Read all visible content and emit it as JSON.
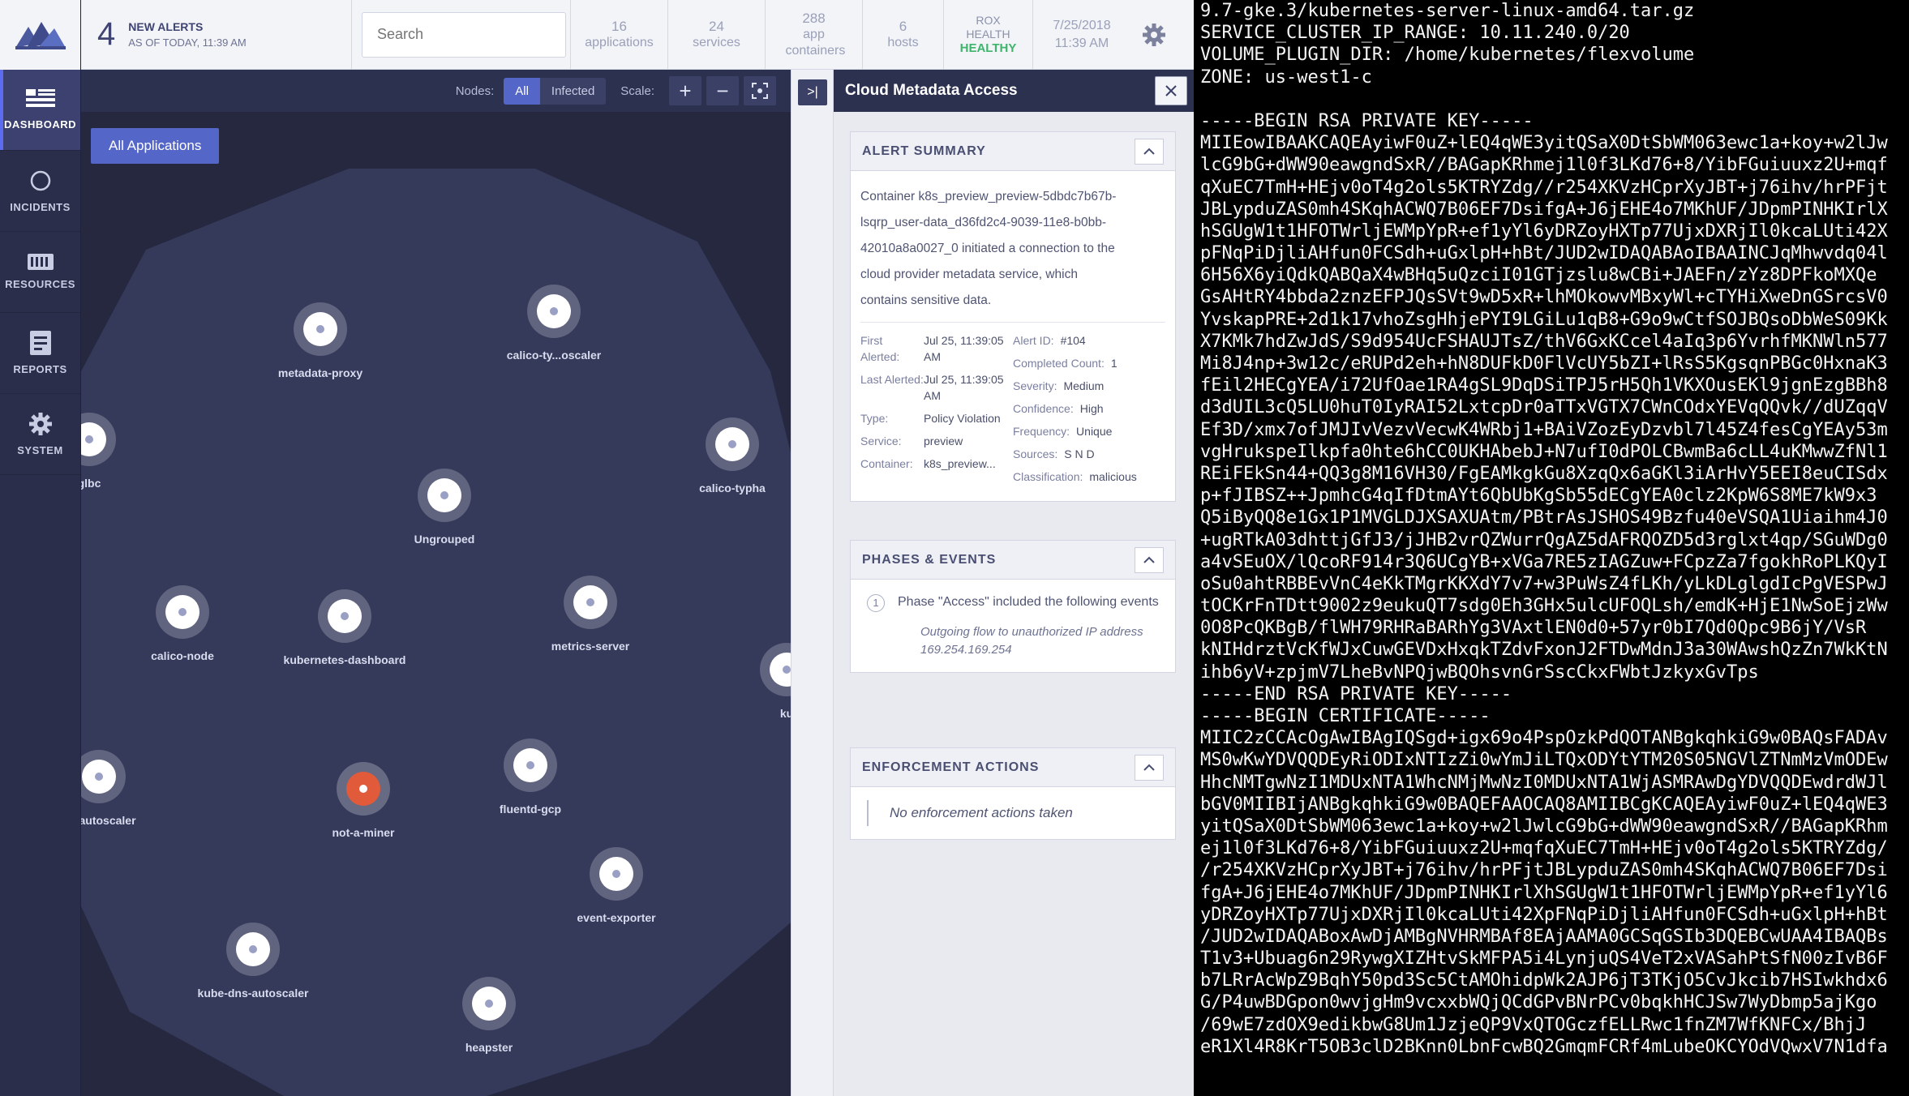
{
  "nav": {
    "items": [
      {
        "label": "DASHBOARD"
      },
      {
        "label": "INCIDENTS"
      },
      {
        "label": "RESOURCES"
      },
      {
        "label": "REPORTS"
      },
      {
        "label": "SYSTEM"
      }
    ]
  },
  "header": {
    "alert_count": "4",
    "alert_title": "NEW ALERTS",
    "alert_sub": "AS OF TODAY, 11:39 AM",
    "search_placeholder": "Search",
    "stats": [
      {
        "num": "16",
        "label": "applications"
      },
      {
        "num": "24",
        "label": "services"
      },
      {
        "num": "288",
        "label": "app containers"
      },
      {
        "num": "6",
        "label": "hosts"
      }
    ],
    "health_line1": "ROX",
    "health_line2": "HEALTH",
    "health_status": "HEALTHY",
    "date": "7/25/2018",
    "time": "11:39 AM"
  },
  "toolbar": {
    "nodes_label": "Nodes:",
    "filter_all": "All",
    "filter_infected": "Infected",
    "scale_label": "Scale:",
    "zoom_in": "+",
    "zoom_out": "−"
  },
  "graph": {
    "all_apps": "All Applications",
    "nodes": [
      {
        "name": "metadata-proxy",
        "status": "normal"
      },
      {
        "name": "calico-ty...oscaler",
        "status": "normal"
      },
      {
        "name": "glbc",
        "status": "normal"
      },
      {
        "name": "calico-typha",
        "status": "normal"
      },
      {
        "name": "Ungrouped",
        "status": "normal"
      },
      {
        "name": "calico-node",
        "status": "normal"
      },
      {
        "name": "kubernetes-dashboard",
        "status": "normal"
      },
      {
        "name": "metrics-server",
        "status": "normal"
      },
      {
        "name": "ku",
        "status": "normal"
      },
      {
        "name": "de-autoscaler",
        "status": "normal"
      },
      {
        "name": "not-a-miner",
        "status": "alert"
      },
      {
        "name": "fluentd-gcp",
        "status": "normal"
      },
      {
        "name": "event-exporter",
        "status": "normal"
      },
      {
        "name": "kube-dns-autoscaler",
        "status": "normal"
      },
      {
        "name": "heapster",
        "status": "normal"
      }
    ]
  },
  "panel": {
    "collapse_label": ">|",
    "title": "Cloud Metadata Access",
    "summary": {
      "heading": "ALERT SUMMARY",
      "lines": [
        "Container k8s_preview_preview-5dbdc7b67b-",
        "lsqrp_user-data_d36fd2c4-9039-11e8-b0bb-",
        "42010a8a0027_0 initiated a connection to the",
        "cloud provider metadata service, which",
        "contains sensitive data."
      ],
      "left": [
        {
          "k": "First Alerted:",
          "v": "Jul 25, 11:39:05 AM"
        },
        {
          "k": "Last Alerted:",
          "v": "Jul 25, 11:39:05 AM"
        },
        {
          "k": "Type:",
          "v": "Policy Violation"
        },
        {
          "k": "Service:",
          "v": "preview"
        },
        {
          "k": "Container:",
          "v": "k8s_preview..."
        }
      ],
      "right": [
        {
          "k": "Alert ID:",
          "v": "#104"
        },
        {
          "k": "Completed Count:",
          "v": "1"
        },
        {
          "k": "Severity:",
          "v": "Medium"
        },
        {
          "k": "Confidence:",
          "v": "High"
        },
        {
          "k": "Frequency:",
          "v": "Unique"
        },
        {
          "k": "Sources:",
          "v": "S N D"
        },
        {
          "k": "Classification:",
          "v": "malicious"
        }
      ]
    },
    "phases": {
      "heading": "PHASES & EVENTS",
      "num": "1",
      "text": "Phase \"Access\" included the following events",
      "event": "Outgoing flow to unauthorized IP address 169.254.169.254"
    },
    "enforcement": {
      "heading": "ENFORCEMENT ACTIONS",
      "text": "No enforcement actions taken"
    }
  },
  "terminal": {
    "lines": [
      "9.7-gke.3/kubernetes-server-linux-amd64.tar.gz",
      "SERVICE_CLUSTER_IP_RANGE: 10.11.240.0/20",
      "VOLUME_PLUGIN_DIR: /home/kubernetes/flexvolume",
      "ZONE: us-west1-c",
      "",
      "-----BEGIN RSA PRIVATE KEY-----",
      "MIIEowIBAAKCAQEAyiwF0uZ+lEQ4qWE3yitQSaX0DtSbWM063ewc1a+koy+w2lJw",
      "lcG9bG+dWW90eawgndSxR//BAGapKRhmej1l0f3LKd76+8/YibFGuiuuxz2U+mqf",
      "qXuEC7TmH+HEjv0oT4g2ols5KTRYZdg//r254XKVzHCprXyJBT+j76ihv/hrPFjt",
      "JBLypduZAS0mh4SKqhACWQ7B06EF7DsifgA+J6jEHE4o7MKhUF/JDpmPINHKIrlX",
      "hSGUgW1t1HFOTWrljEWMpYpR+ef1yYl6yDRZoyHXTp77UjxDXRjIl0kcaLUti42X",
      "pFNqPiDjliAHfun0FCSdh+uGxlpH+hBt/JUD2wIDAQABAoIBAAINCJqMhwvdq04l",
      "6H56X6yiQdkQABQaX4wBHq5uQzciI01GTjzslu8wCBi+JAEFn/zYz8DPFkoMXQe",
      "GsAHtRY4bbda2znzEFPJQsSVt9wD5xR+lhMOkowvMBxyWl+cTYHiXweDnGSrcsV0",
      "YvskapPRE+2d1k17vhoZsgHhjePYI9LGiLu1qB8+G9o9wCtfSOJBQsoDbWeS09Kk",
      "X7KMk7hdZwJdS/S9d954UcFSHAUJTsZ/thV6GxKCcel4aIq3p6YvrhfMKNWln577",
      "Mi8J4np+3w12c/eRUPd2eh+hN8DUFkD0FlVcUY5bZI+lRsS5KgsqnPBGc0HxnaK3",
      "fEil2HECgYEA/i72UfOae1RA4gSL9DqDSiTPJ5rH5Qh1VKXOusEKl9jgnEzgBBh8",
      "d3dUIL3cQ5LU0huT0IyRAI52LxtcpDr0aTTxVGTX7CWnCOdxYEVqQQvk//dUZqqV",
      "Ef3D/xmx7ofJMJIvVezvVecwK4WRbj1+BAiVZozEyDzvbl7l45Z4fesCgYEAy53m",
      "vgHrukspeIlkpfa0hte6hCC0UKHAbebJ+N7ufI0dPOLCBwmBa6cLL4uKMwwZfNl1",
      "REiFEkSn44+QQ3g8M16VH30/FgEAMkgkGu8XzqQx6aGKl3iArHvY5EEI8euCISdx",
      "p+fJIBSZ++JpmhcG4qIfDtmAYt6QbUbKgSb55dECgYEA0clz2KpW6S8ME7kW9x3",
      "Q5iByQQ8e1Gx1P1MVGLDJXSAXUAtm/PBtrAsJSHOS49Bzfu40eVSQA1Uiaihm4J0",
      "+ugRTkA03dhttjGfJ3/jJHB2vrQZWurrQgAZ5dAFRQOZD5d3rglxt4qp/SGuWDg0",
      "a4vSEuOX/lQcoRF914r3Q6UCgYB+xVGa7RE5zIAGZuw+FCpzZa7fgokhRoPLKQyI",
      "oSu0ahtRBBEvVnC4eKkTMgrKKXdY7v7+w3PuWsZ4fLKh/yLkDLglgdIcPgVESPwJ",
      "tOCKrFnTDtt9002z9eukuQT7sdg0Eh3GHx5ulcUFOQLsh/emdK+HjE1NwSoEjzWw",
      "0O8PcQKBgB/flWH79RHRaBARhYg3VAxtlEN0d0+57yr0bI7Qd0Qpc9B6jY/VsR",
      "kNIHdrztVcKfWJxCuwGEVDxHxqkTZdvFxonJ2FTDwMdnJ3a30WAwshQzZn7WkKtN",
      "ihb6yV+zpjmV7LheBvNPQjwBQOhsvnGrSscCkxFWbtJzkyxGvTps",
      "-----END RSA PRIVATE KEY-----",
      "-----BEGIN CERTIFICATE-----",
      "MIIC2zCCAcOgAwIBAgIQSgd+igx69o4PspOzkPdQOTANBgkqhkiG9w0BAQsFADAv",
      "MS0wKwYDVQQDEyRiODIxNTIzZi0wYmJiLTQxODYtYTM20S05NGVlZTNmMzVmODEw",
      "HhcNMTgwNzI1MDUxNTA1WhcNMjMwNzI0MDUxNTA1WjASMRAwDgYDVQQDEwdrdWJl",
      "bGV0MIIBIjANBgkqhkiG9w0BAQEFAAOCAQ8AMIIBCgKCAQEAyiwF0uZ+lEQ4qWE3",
      "yitQSaX0DtSbWM063ewc1a+koy+w2lJwlcG9bG+dWW90eawgndSxR//BAGapKRhm",
      "ej1l0f3LKd76+8/YibFGuiuuxz2U+mqfqXuEC7TmH+HEjv0oT4g2ols5KTRYZdg/",
      "/r254XKVzHCprXyJBT+j76ihv/hrPFjtJBLypduZAS0mh4SKqhACWQ7B06EF7Dsi",
      "fgA+J6jEHE4o7MKhUF/JDpmPINHKIrlXhSGUgW1t1HFOTWrljEWMpYpR+ef1yYl6",
      "yDRZoyHXTp77UjxDXRjIl0kcaLUti42XpFNqPiDjliAHfun0FCSdh+uGxlpH+hBt",
      "/JUD2wIDAQABoxAwDjAMBgNVHRMBAf8EAjAAMA0GCSqGSIb3DQEBCwUAA4IBAQBs",
      "T1v3+Ubuag6n29RywgXIZHtvSkMFPA5i4LynjuQS4VeT2xVASahPtSfN00zIvB6F",
      "b7LRrAcWpZ9BqhY50pd3Sc5CtAMOhidpWk2AJP6jT3TKjO5CvJkcib7HSIwkhdx6",
      "G/P4uwBDGpon0wvjgHm9vcxxbWQjQCdGPvBNrPCv0bqkhHCJSw7WyDbmp5ajKgo",
      "/69wE7zdOX9edikbwG8Um1JzjeQP9VxQTOGczfELLRwc1fnZM7WfKNFCx/BhjJ",
      "eR1Xl4R8KrT5OB3clD2BKnn0LbnFcwBQ2GmqmFCRf4mLubeOKCYOdVQwxV7N1dfa"
    ]
  }
}
